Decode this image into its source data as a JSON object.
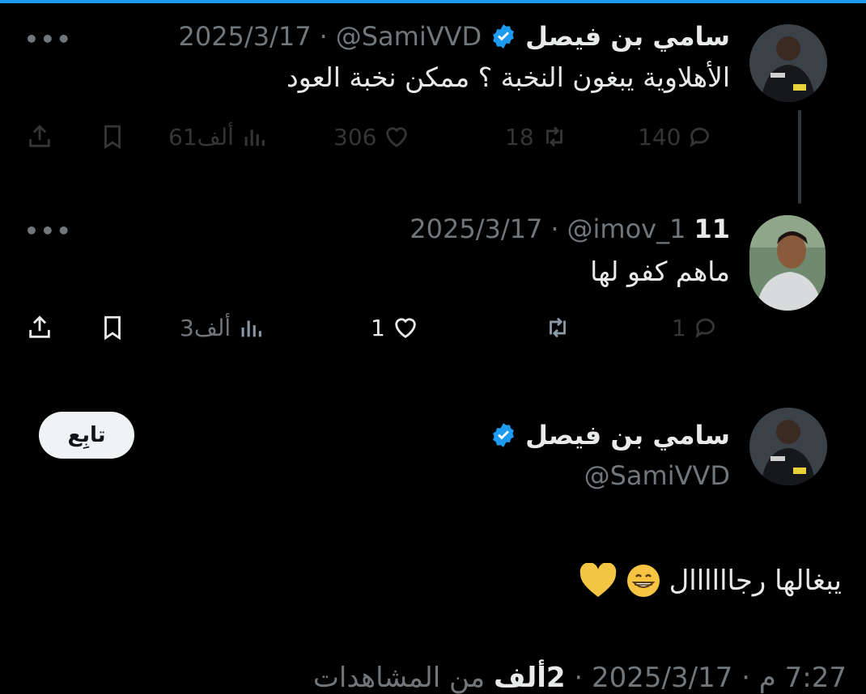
{
  "tweet1": {
    "name": "سامي بن فيصل",
    "handle": "@SamiVVD",
    "dot": "·",
    "date": "2025/3/17",
    "text": "الأهلاوية يبغون النخبة ؟ ممكن نخبة العود",
    "more": "•••",
    "replies": "140",
    "retweets": "18",
    "likes": "306",
    "views": "61ألف"
  },
  "tweet2": {
    "name": "11",
    "handle": "@imov_1",
    "dot": "·",
    "date": "2025/3/17",
    "text": "ماهم كفو لها",
    "more": "•••",
    "replies": "1",
    "likes": "1",
    "views": "3ألف"
  },
  "tweet3": {
    "name": "سامي بن فيصل",
    "handle": "@SamiVVD",
    "follow_label": "تابِع",
    "text": "يبغالها رجاااااال",
    "emojis": [
      "grinning-face-icon",
      "yellow-heart-icon"
    ]
  },
  "footer": {
    "time": "7:27 م",
    "date": "2025/3/17",
    "sep": "·",
    "views_count": "2ألف",
    "views_label": "من المشاهدات"
  },
  "colors": {
    "background": "#000000",
    "text": "#e7e9ea",
    "muted": "#71767b",
    "verified": "#1d9bf0",
    "follow_bg": "#eff3f4",
    "heart": "#f4c542"
  }
}
